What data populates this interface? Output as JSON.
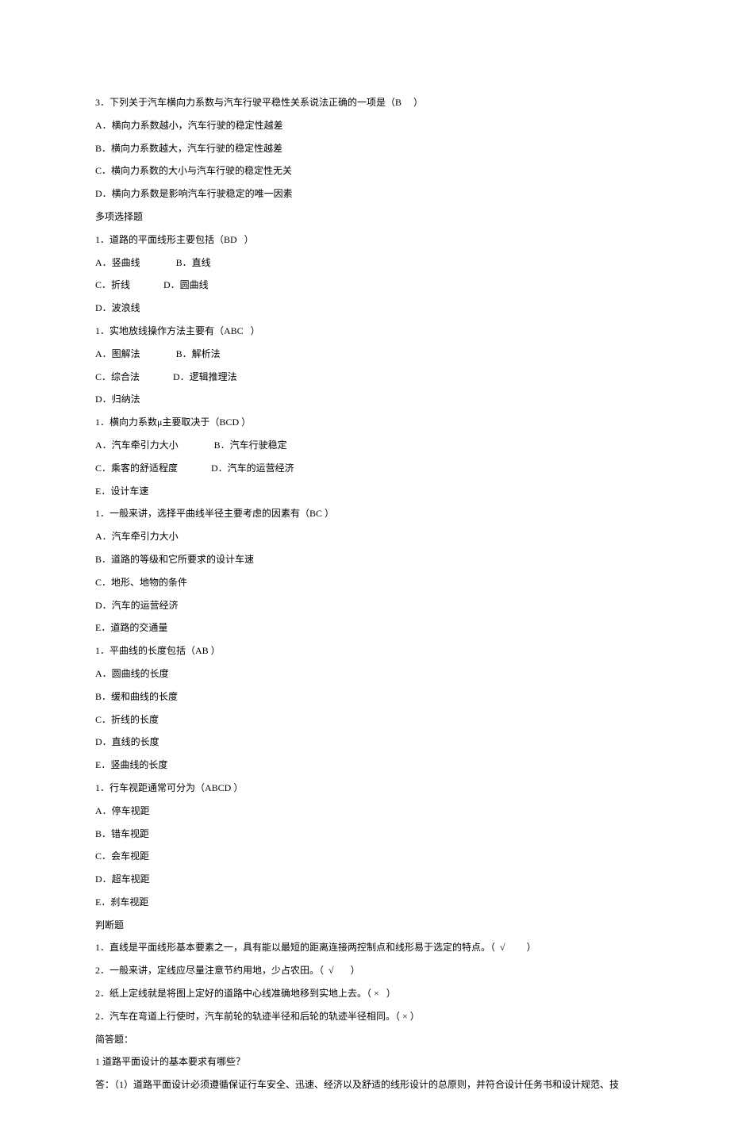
{
  "lines": [
    "3．下列关于汽车横向力系数与汽车行驶平稳性关系说法正确的一项是（B     ）",
    "A．横向力系数越小，汽车行驶的稳定性越差",
    "B．横向力系数越大，汽车行驶的稳定性越差",
    "C．横向力系数的大小与汽车行驶的稳定性无关",
    "D．横向力系数是影响汽车行驶稳定的唯一因素",
    "多项选择题",
    "1．道路的平面线形主要包括（BD   ）",
    "A．竖曲线               B．直线",
    "C．折线              D．圆曲线",
    "D．波浪线",
    "1．实地放线操作方法主要有（ABC   ）",
    "A．图解法               B．解析法",
    "C．综合法              D．逻辑推理法",
    "D．归纳法",
    "1．横向力系数μ主要取决于（BCD ）",
    "A．汽车牵引力大小               B．汽车行驶稳定",
    "C．乘客的舒适程度              D．汽车的运营经济",
    "E．设计车速",
    "1．一般来讲，选择平曲线半径主要考虑的因素有（BC ）",
    "A．汽车牵引力大小",
    "B．道路的等级和它所要求的设计车速",
    "C．地形、地物的条件",
    "D．汽车的运营经济",
    "E．道路的交通量",
    "1．平曲线的长度包括（AB ）",
    "A．圆曲线的长度",
    "B．缓和曲线的长度",
    "C．折线的长度",
    "D．直线的长度",
    "E．竖曲线的长度",
    "1．行车视距通常可分为（ABCD ）",
    "A．停车视距",
    "B．错车视距",
    "C．会车视距",
    "D．超车视距",
    "E．刹车视距",
    "判断题",
    "1．直线是平面线形基本要素之一，具有能以最短的距离连接两控制点和线形易于选定的特点。（  √         ）",
    "2．一般来讲，定线应尽量注意节约用地，少占农田。（  √       ）",
    "2．纸上定线就是将图上定好的道路中心线准确地移到实地上去。（ ×   ）",
    "2．汽车在弯道上行使时，汽车前轮的轨迹半径和后轮的轨迹半径相同。（ × ）",
    "简答题：",
    "1 道路平面设计的基本要求有哪些？",
    "答：（1）道路平面设计必须遵循保证行车安全、迅速、经济以及舒适的线形设计的总原则，并符合设计任务书和设计规范、技"
  ]
}
